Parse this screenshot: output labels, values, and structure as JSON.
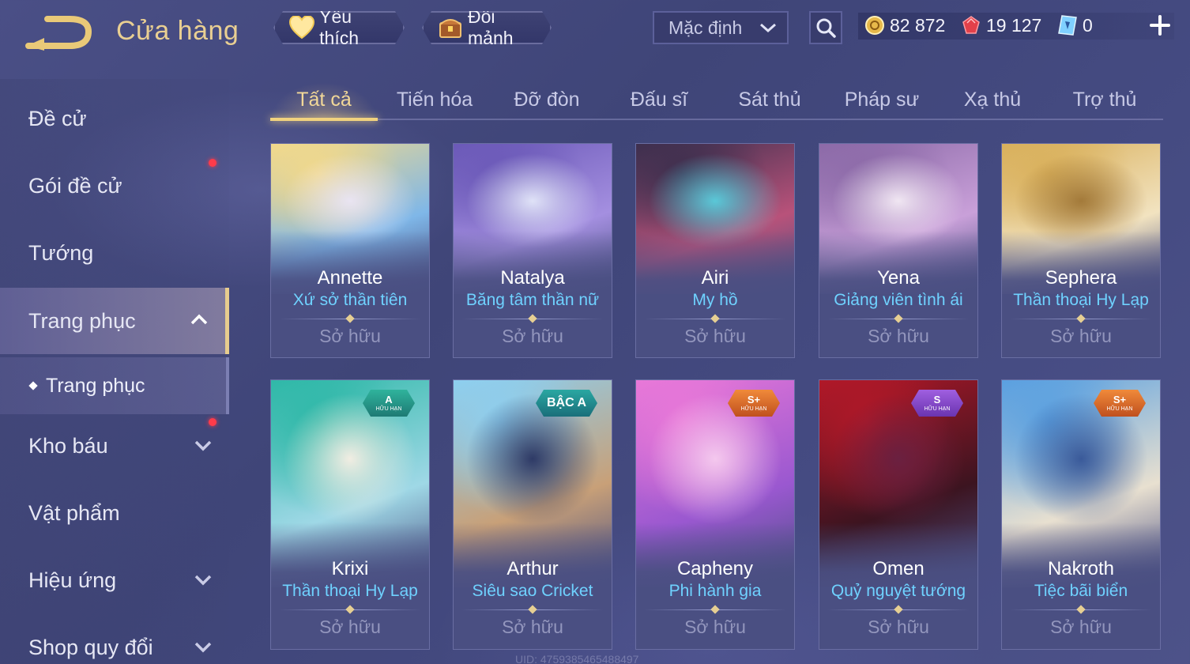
{
  "header": {
    "title": "Cửa hàng",
    "favorite_label": "Yêu thích",
    "exchange_label": "Đổi mảnh",
    "sort_value": "Mặc định",
    "currencies": {
      "gold": "82 872",
      "ruby": "19 127",
      "voucher": "0"
    }
  },
  "sidebar": {
    "items": [
      {
        "label": "Đề cử"
      },
      {
        "label": "Gói đề cử"
      },
      {
        "label": "Tướng"
      },
      {
        "label": "Trang phục"
      },
      {
        "label": "Kho báu"
      },
      {
        "label": "Vật phẩm"
      },
      {
        "label": "Hiệu ứng"
      },
      {
        "label": "Shop quy đổi"
      }
    ],
    "sub_item": "Trang phục"
  },
  "tabs": [
    "Tất cả",
    "Tiến hóa",
    "Đỡ đòn",
    "Đấu sĩ",
    "Sát thủ",
    "Pháp sư",
    "Xạ thủ",
    "Trợ thủ"
  ],
  "cards": [
    {
      "hero": "Annette",
      "skin": "Xứ sở thần tiên",
      "status": "Sở hữu",
      "colors": [
        "#f3d98a",
        "#7fb7e8",
        "#e9e4f2"
      ]
    },
    {
      "hero": "Natalya",
      "skin": "Băng tâm thần nữ",
      "status": "Sở hữu",
      "colors": [
        "#6b59b8",
        "#a48fe0",
        "#dfe2f7"
      ]
    },
    {
      "hero": "Airi",
      "skin": "My hồ",
      "status": "Sở hữu",
      "colors": [
        "#3d2f4e",
        "#b8527a",
        "#5ac8d8"
      ]
    },
    {
      "hero": "Yena",
      "skin": "Giảng viên tình ái",
      "status": "Sở hữu",
      "colors": [
        "#8c6aa8",
        "#c9a0d9",
        "#f0e6f2"
      ]
    },
    {
      "hero": "Sephera",
      "skin": "Thần thoại Hy Lạp",
      "status": "Sở hữu",
      "colors": [
        "#d9b05b",
        "#f2e3c0",
        "#a37a3a"
      ]
    },
    {
      "hero": "Krixi",
      "skin": "Thần thoại Hy Lạp",
      "status": "Sở hữu",
      "badge": "A",
      "badge_sub": "HỮU HẠN",
      "colors": [
        "#2fb8a8",
        "#9fd8e6",
        "#f1ede2"
      ]
    },
    {
      "hero": "Arthur",
      "skin": "Siêu sao Cricket",
      "status": "Sở hữu",
      "badge": "BẬC A",
      "colors": [
        "#8dcff0",
        "#c8a078",
        "#2e3a66"
      ]
    },
    {
      "hero": "Capheny",
      "skin": "Phi hành gia",
      "status": "Sở hữu",
      "badge": "S+",
      "badge_sub": "HỮU HẠN",
      "colors": [
        "#e878d8",
        "#9a58d0",
        "#f4c8ee"
      ]
    },
    {
      "hero": "Omen",
      "skin": "Quỷ nguyệt tướng",
      "status": "Sở hữu",
      "badge": "S",
      "badge_sub": "HỮU HẠN",
      "colors": [
        "#b01828",
        "#3c1420",
        "#6a2040"
      ]
    },
    {
      "hero": "Nakroth",
      "skin": "Tiệc bãi biển",
      "status": "Sở hữu",
      "badge": "S+",
      "badge_sub": "HỮU HẠN",
      "colors": [
        "#5aa0e0",
        "#e8e0d0",
        "#3a5a9a"
      ]
    }
  ],
  "uid_text": "UID: 4759385465488497"
}
